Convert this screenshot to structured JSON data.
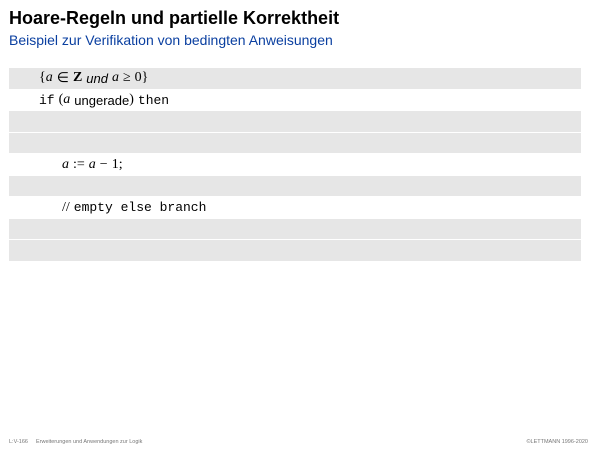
{
  "slide": {
    "title": "Hoare-Regeln und partielle Korrektheit",
    "subtitle": "Beispiel zur Verifikation von bedingten Anweisungen"
  },
  "code": {
    "precondition": {
      "open_brace": "{",
      "var_a": "a",
      "element_of": "∈",
      "set_Z": "Z",
      "und": "und",
      "var_a2": "a",
      "geq": "≥",
      "zero": "0",
      "close_brace": "}"
    },
    "if_line": {
      "kw_if": "if",
      "open_paren": "(",
      "var_a": "a",
      "condition": "ungerade",
      "close_paren": ")",
      "kw_then": "then"
    },
    "assignment": {
      "var_a": "a",
      "assign": ":=",
      "var_a2": "a",
      "minus": "−",
      "one": "1",
      "semicolon": ";"
    },
    "else_comment": {
      "slashes": "//",
      "text": "empty else branch"
    }
  },
  "footer": {
    "slide_number": "L:V-166",
    "course": "Erweiterungen und Anwendungen zur Logik",
    "copyright": "©LETTMANN 1996-2020"
  },
  "colors": {
    "subtitle": "#0a3fa0",
    "row_shade": "#e6e6e6"
  }
}
